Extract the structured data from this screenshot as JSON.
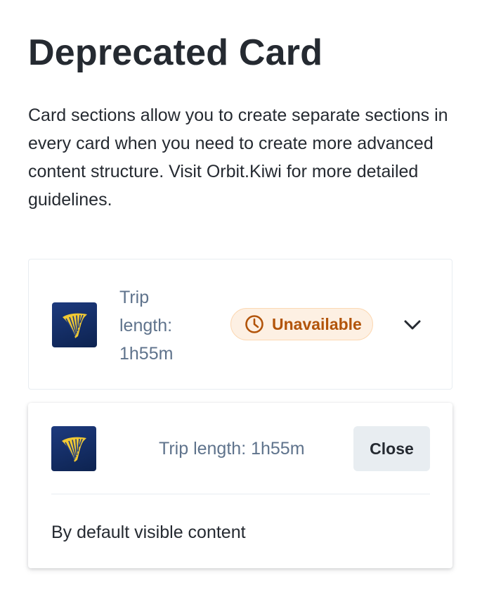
{
  "page": {
    "title": "Deprecated Card",
    "description": "Card sections allow you to create separate sections in every card when you need to create more advanced content structure. Visit Orbit.Kiwi for more detailed guidelines."
  },
  "card_collapsed": {
    "trip_length": "Trip length: 1h55m",
    "badge_label": "Unavailable",
    "logo_icon": "ryanair-harp-icon",
    "badge_icon": "clock-icon",
    "toggle_icon": "chevron-down-icon"
  },
  "card_expanded": {
    "trip_length": "Trip length: 1h55m",
    "close_label": "Close",
    "content": "By default visible content",
    "logo_icon": "ryanair-harp-icon"
  },
  "colors": {
    "text_primary": "#252a31",
    "text_secondary": "#5f738c",
    "badge_bg": "#fdf0e3",
    "badge_border": "#fcd8b3",
    "badge_text": "#b2540a",
    "logo_bg": "#1d3a7e",
    "logo_harp": "#f1c933",
    "button_bg": "#e8edf1"
  }
}
